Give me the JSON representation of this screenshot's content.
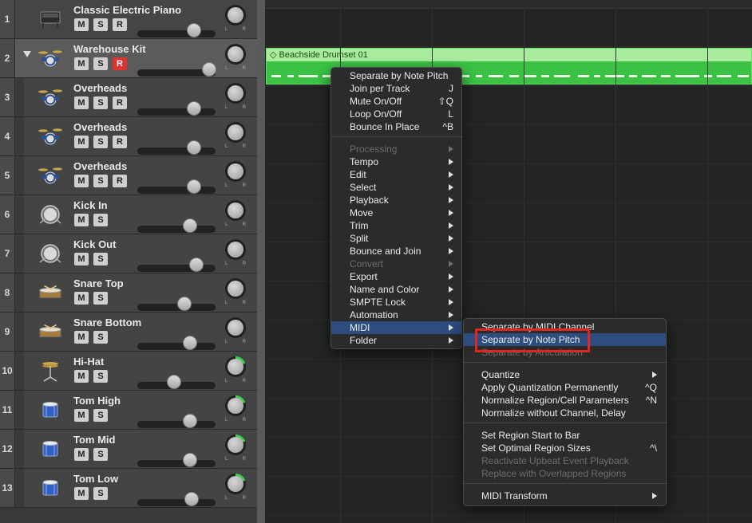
{
  "tracks": [
    {
      "num": "1",
      "name": "Classic Electric Piano",
      "buttons": [
        "M",
        "S",
        "R"
      ],
      "fader": 0.72,
      "icon": "piano-icon",
      "selected": false,
      "sub": false
    },
    {
      "num": "2",
      "name": "Warehouse Kit",
      "buttons": [
        "M",
        "S",
        "R"
      ],
      "rec_active": true,
      "fader": 0.92,
      "icon": "drum-kit-icon",
      "selected": true,
      "sub": false,
      "disclosure": true
    },
    {
      "num": "3",
      "name": "Overheads",
      "buttons": [
        "M",
        "S",
        "R"
      ],
      "fader": 0.72,
      "icon": "drum-kit-icon",
      "sub": true
    },
    {
      "num": "4",
      "name": "Overheads",
      "buttons": [
        "M",
        "S",
        "R"
      ],
      "fader": 0.72,
      "icon": "drum-kit-icon",
      "sub": true
    },
    {
      "num": "5",
      "name": "Overheads",
      "buttons": [
        "M",
        "S",
        "R"
      ],
      "fader": 0.72,
      "icon": "drum-kit-icon",
      "sub": true
    },
    {
      "num": "6",
      "name": "Kick In",
      "buttons": [
        "M",
        "S"
      ],
      "fader": 0.67,
      "icon": "kick-drum-icon",
      "sub": true
    },
    {
      "num": "7",
      "name": "Kick Out",
      "buttons": [
        "M",
        "S"
      ],
      "fader": 0.75,
      "icon": "kick-drum-icon",
      "sub": true
    },
    {
      "num": "8",
      "name": "Snare Top",
      "buttons": [
        "M",
        "S"
      ],
      "fader": 0.6,
      "icon": "snare-drum-icon",
      "sub": true
    },
    {
      "num": "9",
      "name": "Snare Bottom",
      "buttons": [
        "M",
        "S"
      ],
      "fader": 0.67,
      "icon": "snare-drum-icon",
      "sub": true
    },
    {
      "num": "10",
      "name": "Hi-Hat",
      "buttons": [
        "M",
        "S"
      ],
      "fader": 0.47,
      "icon": "hi-hat-icon",
      "sub": true,
      "pan_green": true
    },
    {
      "num": "11",
      "name": "Tom High",
      "buttons": [
        "M",
        "S"
      ],
      "fader": 0.67,
      "icon": "tom-drum-icon",
      "sub": true,
      "pan_green": true
    },
    {
      "num": "12",
      "name": "Tom Mid",
      "buttons": [
        "M",
        "S"
      ],
      "fader": 0.67,
      "icon": "tom-drum-icon",
      "sub": true,
      "pan_green": true
    },
    {
      "num": "13",
      "name": "Tom Low",
      "buttons": [
        "M",
        "S"
      ],
      "fader": 0.69,
      "icon": "tom-drum-icon",
      "sub": true,
      "pan_green": true
    }
  ],
  "knob_labels": {
    "left": "L",
    "right": "R"
  },
  "region": {
    "name": "Beachside Drumset 01",
    "prefix": "◇"
  },
  "context_menu": {
    "items": [
      {
        "label": "Separate by Note Pitch",
        "shortcut": ""
      },
      {
        "label": "Join per Track",
        "shortcut": "J"
      },
      {
        "label": "Mute On/Off",
        "shortcut": "⇧Q"
      },
      {
        "label": "Loop On/Off",
        "shortcut": "L"
      },
      {
        "label": "Bounce In Place",
        "shortcut": "^B"
      },
      {
        "separator": true
      },
      {
        "label": "Processing",
        "submenu": true,
        "disabled": true
      },
      {
        "label": "Tempo",
        "submenu": true
      },
      {
        "label": "Edit",
        "submenu": true
      },
      {
        "label": "Select",
        "submenu": true
      },
      {
        "label": "Playback",
        "submenu": true
      },
      {
        "label": "Move",
        "submenu": true
      },
      {
        "label": "Trim",
        "submenu": true
      },
      {
        "label": "Split",
        "submenu": true
      },
      {
        "label": "Bounce and Join",
        "submenu": true
      },
      {
        "label": "Convert",
        "submenu": true,
        "disabled": true
      },
      {
        "label": "Export",
        "submenu": true
      },
      {
        "label": "Name and Color",
        "submenu": true
      },
      {
        "label": "SMPTE Lock",
        "submenu": true
      },
      {
        "label": "Automation",
        "submenu": true
      },
      {
        "label": "MIDI",
        "submenu": true,
        "highlighted": true
      },
      {
        "label": "Folder",
        "submenu": true
      }
    ]
  },
  "midi_submenu": {
    "items": [
      {
        "label": "Separate by MIDI Channel",
        "shortcut": ""
      },
      {
        "label": "Separate by Note Pitch",
        "shortcut": "",
        "highlighted": true
      },
      {
        "label": "Separate by Articulation",
        "shortcut": "",
        "disabled": true
      },
      {
        "separator": true
      },
      {
        "label": "Quantize",
        "submenu": true
      },
      {
        "label": "Apply Quantization Permanently",
        "shortcut": "^Q"
      },
      {
        "label": "Normalize Region/Cell Parameters",
        "shortcut": "^N"
      },
      {
        "label": "Normalize without Channel, Delay",
        "shortcut": ""
      },
      {
        "separator": true
      },
      {
        "label": "Set Region Start to Bar",
        "shortcut": ""
      },
      {
        "label": "Set Optimal Region Sizes",
        "shortcut": "^\\"
      },
      {
        "label": "Reactivate Upbeat Event Playback",
        "disabled": true
      },
      {
        "label": "Replace with Overlapped Regions",
        "disabled": true
      },
      {
        "separator": true
      },
      {
        "label": "MIDI Transform",
        "submenu": true
      }
    ]
  },
  "colors": {
    "region": "#3bc244",
    "highlight": "#2d4d7e",
    "record_active": "#e0332e",
    "annotation": "#e0271f",
    "pan_ring": "#3fcf48"
  }
}
